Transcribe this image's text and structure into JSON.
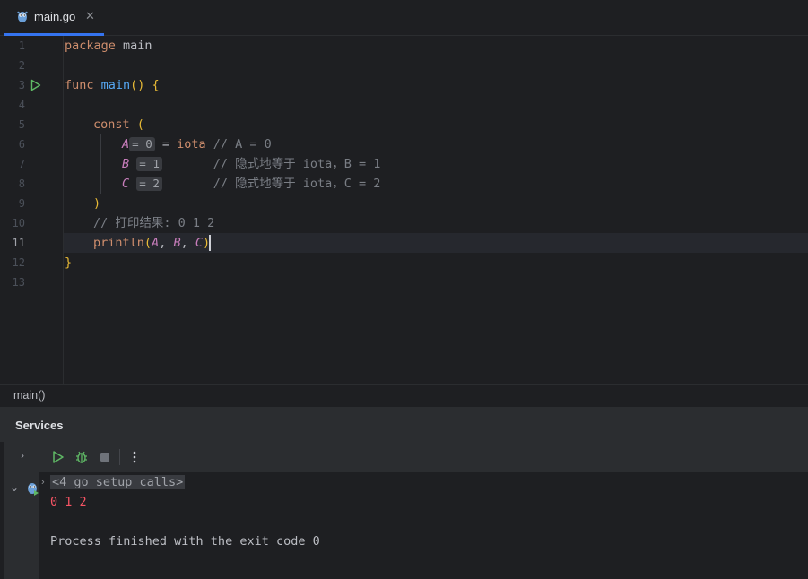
{
  "tab": {
    "label": "main.go",
    "close": "✕",
    "icon": "gopher-icon"
  },
  "editor": {
    "line_numbers": [
      "1",
      "2",
      "3",
      "4",
      "5",
      "6",
      "7",
      "8",
      "9",
      "10",
      "11",
      "12",
      "13"
    ],
    "current_line": "11",
    "lines": {
      "l1_kw": "package",
      "l1_name": " main",
      "l3_kw": "func",
      "l3_fn": " main",
      "l3_rest": "() {",
      "l5_kw": "const",
      "l5_br": " (",
      "l6_const": "A",
      "l6_hint": "= 0",
      "l6_eq": " = ",
      "l6_iota": "iota",
      "l6_cmt": " // A = 0",
      "l7_const": "B",
      "l7_hint": "= 1",
      "l7_cmt": "       // 隐式地等于 iota，B = 1",
      "l8_const": "C",
      "l8_hint": "= 2",
      "l8_cmt": "       // 隐式地等于 iota，C = 2",
      "l9_br": ")",
      "l10_cmt": "// 打印结果: 0 1 2",
      "l11_fn": "println",
      "l11_open": "(",
      "l11_a": "A",
      "l11_sep1": ", ",
      "l11_b": "B",
      "l11_sep2": ", ",
      "l11_c": "C",
      "l11_close": ")",
      "l12_br": "}"
    }
  },
  "breadcrumb": {
    "label": "main()"
  },
  "services": {
    "title": "Services",
    "console": {
      "setup_calls": "<4 go setup calls>",
      "output": "0 1 2",
      "exit": "Process finished with the exit code 0"
    }
  },
  "colors": {
    "accent": "#3574f0",
    "run_green": "#5fb865",
    "error_red": "#f75464"
  }
}
